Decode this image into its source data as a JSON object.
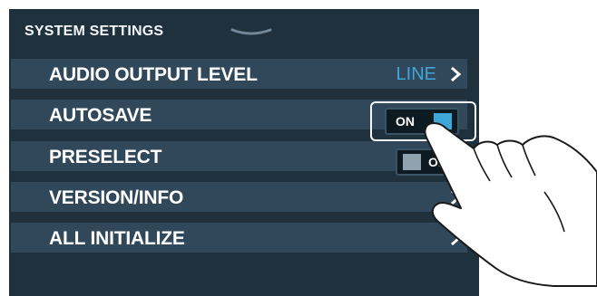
{
  "header": {
    "title": "SYSTEM SETTINGS"
  },
  "rows": [
    {
      "label": "AUDIO OUTPUT LEVEL",
      "value": "LINE"
    },
    {
      "label": "AUTOSAVE",
      "toggle": "ON"
    },
    {
      "label": "PRESELECT",
      "toggle": "OFF"
    },
    {
      "label": "VERSION/INFO"
    },
    {
      "label": "ALL INITIALIZE"
    }
  ],
  "toggle_labels": {
    "autosave": "ON",
    "preselect": "OF"
  },
  "colors": {
    "accent": "#3fa6d8",
    "row_bg": "#30485a",
    "screen_bg": "#1f313d"
  }
}
